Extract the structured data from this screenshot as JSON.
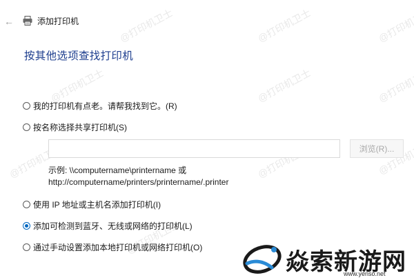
{
  "window": {
    "title": "添加打印机"
  },
  "heading": "按其他选项查找打印机",
  "options": [
    {
      "label": "我的打印机有点老。请帮我找到它。(R)",
      "checked": false
    },
    {
      "label": "按名称选择共享打印机(S)",
      "checked": false
    },
    {
      "label": "使用 IP 地址或主机名添加打印机(I)",
      "checked": false
    },
    {
      "label": "添加可检测到蓝牙、无线或网络的打印机(L)",
      "checked": true
    },
    {
      "label": "通过手动设置添加本地打印机或网络打印机(O)",
      "checked": false
    }
  ],
  "share": {
    "input_value": "",
    "browse_label": "浏览(R)...",
    "example_line1": "示例: \\\\computername\\printername 或",
    "example_line2": "http://computername/printers/printername/.printer"
  },
  "watermark": {
    "text": "@打印机卫士"
  },
  "brand": {
    "name": "焱索新游网",
    "url": "www.yenso.net"
  },
  "colors": {
    "heading": "#1f3f8f",
    "accent": "#0067c0"
  },
  "icons": {
    "back": "back-arrow-icon",
    "printer": "printer-icon",
    "brand_logo": "brand-logo-icon"
  }
}
